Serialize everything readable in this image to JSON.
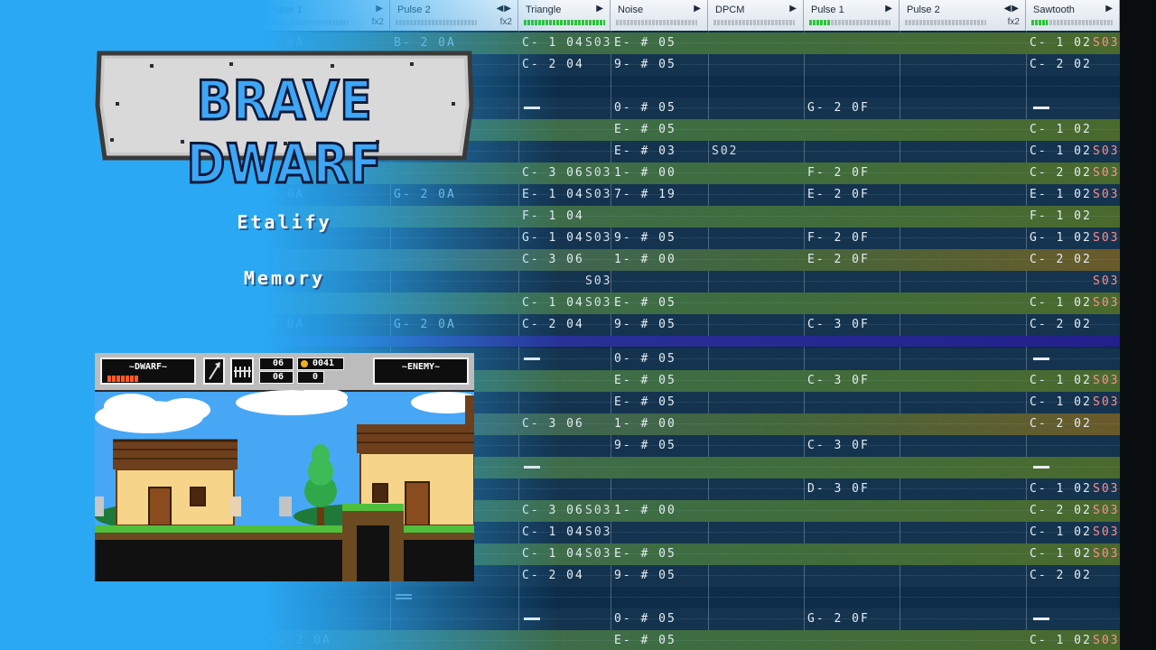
{
  "game": {
    "title": "BRAVE DWARF",
    "credits": [
      "Etalify",
      "Memory"
    ],
    "hud": {
      "left_label": "~DWARF~",
      "right_label": "~ENEMY~",
      "stat_1": "06",
      "stat_2": "0041",
      "stat_3": "06",
      "stat_4": "0"
    }
  },
  "tracker": {
    "channels": [
      {
        "name": "Pulse 1",
        "fx": "fx2",
        "level": 0.0
      },
      {
        "name": "Pulse 2",
        "fx": "fx2",
        "level": 0.0
      },
      {
        "name": "Triangle",
        "fx": "",
        "level": 1.0
      },
      {
        "name": "Noise",
        "fx": "",
        "level": 0.0
      },
      {
        "name": "DPCM",
        "fx": "",
        "level": 0.0
      },
      {
        "name": "Pulse 1",
        "fx": "",
        "level": 0.25
      },
      {
        "name": "Pulse 2",
        "fx": "fx2",
        "level": 0.0
      },
      {
        "name": "Sawtooth",
        "fx": "",
        "level": 0.2
      }
    ],
    "rows": [
      {
        "c0": "3 0A",
        "c1": "B- 2 0A",
        "c2": "C- 1 04",
        "c2fx": "S03",
        "c3": "E- # 05",
        "c7": "C- 1 02",
        "c7fx": "S03",
        "band": true
      },
      {
        "c2": "C- 2 04",
        "c3": "9- # 05",
        "c7": "C- 2 02"
      },
      {
        "sep": true
      },
      {
        "c2dash": true,
        "c3": "0- # 05",
        "c5": "G- 2 0F",
        "c7dash": true
      },
      {
        "c3": "E- # 05",
        "c7": "C- 1 02",
        "band": true
      },
      {
        "c3": "E- # 03",
        "c4fx": "S02",
        "c7": "C- 1 02",
        "c7fx": "S03"
      },
      {
        "c2": "C- 3 06",
        "c2fx": "S03",
        "c3": "1- # 00",
        "c5": "F- 2 0F",
        "c7": "C- 2 02",
        "c7fx": "S03",
        "band": true
      },
      {
        "c0": "3 0A",
        "c1": "G- 2 0A",
        "c2": "E- 1 04",
        "c2fx": "S03",
        "c3": "7- # 19",
        "c5": "E- 2 0F",
        "c7": "E- 1 02",
        "c7fx": "S03"
      },
      {
        "c2": "F- 1 04",
        "c7": "F- 1 02",
        "band": true
      },
      {
        "c2": "G- 1 04",
        "c2fx": "S03",
        "c3": "9- # 05",
        "c5": "F- 2 0F",
        "c7": "G- 1 02",
        "c7fx": "S03"
      },
      {
        "c2": "C- 3 06",
        "c3": "1- # 00",
        "c5": "E- 2 0F",
        "c7": "C- 2 02",
        "band2": true
      },
      {
        "c2fx": "S03",
        "c7fx": "S03"
      },
      {
        "c2": "C- 1 04",
        "c2fx": "S03",
        "c3": "E- # 05",
        "c7": "C- 1 02",
        "c7fx": "S03",
        "band": true
      },
      {
        "c0": "3 0A",
        "c1": "G- 2 0A",
        "c2": "C- 2 04",
        "c3": "9- # 05",
        "c5": "C- 3 0F",
        "c7": "C- 2 02"
      },
      {
        "cursor": true
      },
      {
        "c2dash": true,
        "c3": "0- # 05",
        "c7dash": true
      },
      {
        "c3": "E- # 05",
        "c5": "C- 3 0F",
        "c7": "C- 1 02",
        "c7fx": "S03",
        "band": true
      },
      {
        "c3": "E- # 05",
        "c7": "C- 1 02",
        "c7fx": "S03"
      },
      {
        "c2": "C- 3 06",
        "c3": "1- # 00",
        "c7": "C- 2 02",
        "band2": true
      },
      {
        "c3": "9- # 05",
        "c5": "C- 3 0F"
      },
      {
        "c2dash": true,
        "c7dash": true,
        "band": true
      },
      {
        "c5": "D- 3 0F",
        "c7": "C- 1 02",
        "c7fx": "S03"
      },
      {
        "c2": "C- 3 06",
        "c2fx": "S03",
        "c3": "1- # 00",
        "c7": "C- 2 02",
        "c7fx": "S03",
        "band": true
      },
      {
        "c2": "C- 1 04",
        "c2fx": "S03",
        "c7": "C- 1 02",
        "c7fx": "S03"
      },
      {
        "c2": "C- 1 04",
        "c2fx": "S03",
        "c3": "E- # 05",
        "c7": "C- 1 02",
        "c7fx": "S03",
        "band": true
      },
      {
        "c2": "C- 2 04",
        "c3": "9- # 05",
        "c7": "C- 2 02"
      },
      {
        "sep": true
      },
      {
        "c2dash": true,
        "c3": "0- # 05",
        "c5": "G- 2 0F",
        "c7dash": true
      },
      {
        "c0": "A- 2 0A",
        "c3": "E- # 05",
        "c7": "C- 1 02",
        "c7fx": "S03",
        "band": true
      }
    ]
  }
}
